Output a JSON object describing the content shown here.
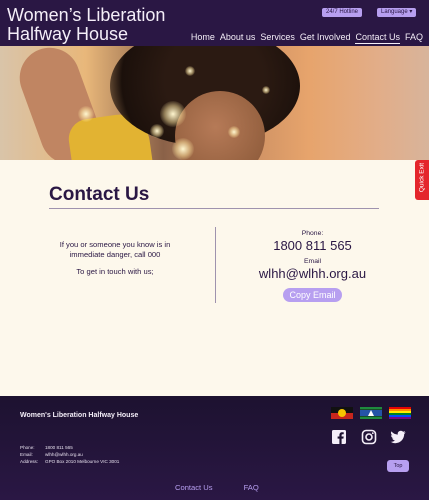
{
  "header": {
    "org_line1": "Women’s Liberation",
    "org_line2": "Halfway House",
    "hotline_label": "24/7 Hotline",
    "language_label": "Language",
    "nav": [
      "Home",
      "About us",
      "Services",
      "Get Involved",
      "Contact Us",
      "FAQ"
    ],
    "active_nav": "Contact Us"
  },
  "quick_exit": {
    "label": "Quick Exit"
  },
  "contact": {
    "title": "Contact Us",
    "danger_text": "If you or someone you know is in immediate danger, call 000",
    "touch_text": "To get in touch with us;",
    "phone_label": "Phone:",
    "phone": "1800 811 565",
    "email_label": "Email",
    "email": "wlhh@wlhh.org.au",
    "copy_button": "Copy Email"
  },
  "footer": {
    "org_name": "Women's Liberation Halfway House",
    "phone_label": "Phone:",
    "phone": "1800 811 565",
    "email_label": "Email:",
    "email": "wlhh@wlhh.org.au",
    "address_label": "Address:",
    "address": "GPO Box 2010 Melbourne VIC 3001",
    "top_button": "Top",
    "links": [
      "Contact Us",
      "FAQ"
    ],
    "icons": [
      "aboriginal-flag-icon",
      "torres-strait-flag-icon",
      "pride-flag-icon",
      "facebook-icon",
      "instagram-icon",
      "twitter-icon"
    ]
  },
  "colors": {
    "brand_dark": "#2a1744",
    "accent_lavender": "#b79ff0",
    "quick_exit_red": "#e4262c",
    "page_bg": "#fdf8ec"
  }
}
